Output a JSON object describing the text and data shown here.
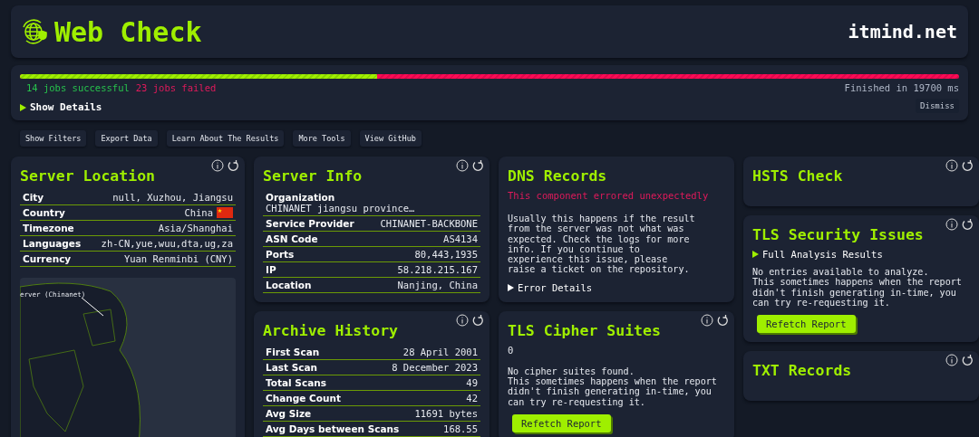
{
  "header": {
    "title": "Web Check",
    "domain": "itmind.net"
  },
  "progress": {
    "level": 0.38,
    "successful": "14 jobs successful",
    "failed": "23 jobs failed",
    "finished": "Finished in 19700 ms",
    "details": {
      "label": "Show Details",
      "expanded": false
    },
    "dismiss": "Dismiss"
  },
  "actions": [
    "Show Filters",
    "Export Data",
    "Learn About The Results",
    "More Tools",
    "View GitHub"
  ],
  "columns": [
    [
      {
        "kind": "table",
        "title": "Server Location",
        "tools": true,
        "rows": [
          {
            "label": "City",
            "value": "null, Xuzhou, Jiangsu"
          },
          {
            "label": "Country",
            "value": "China",
            "flag": true
          },
          {
            "label": "Timezone",
            "value": "Asia/Shanghai"
          },
          {
            "label": "Languages",
            "value": "zh-CN,yue,wuu,dta,ug,za"
          },
          {
            "label": "Currency",
            "value": "Yuan Renminbi (CNY)"
          }
        ],
        "map": {
          "label": "erver (Chinanet)"
        }
      }
    ],
    [
      {
        "kind": "table",
        "title": "Server Info",
        "tools": true,
        "rows": [
          {
            "label": "Organization",
            "value": "CHINANET jiangsu province…",
            "stacked": true
          },
          {
            "label": "Service Provider",
            "value": "CHINANET-BACKBONE"
          },
          {
            "label": "ASN Code",
            "value": "AS4134"
          },
          {
            "label": "Ports",
            "value": "80,443,1935"
          },
          {
            "label": "IP",
            "value": "58.218.215.167"
          },
          {
            "label": "Location",
            "value": "Nanjing, China"
          }
        ]
      },
      {
        "kind": "table",
        "title": "Archive History",
        "tools": true,
        "rows": [
          {
            "label": "First Scan",
            "value": "28 April 2001"
          },
          {
            "label": "Last Scan",
            "value": "8 December 2023"
          },
          {
            "label": "Total Scans",
            "value": "49"
          },
          {
            "label": "Change Count",
            "value": "42"
          },
          {
            "label": "Avg Size",
            "value": "11691 bytes"
          },
          {
            "label": "Avg Days between Scans",
            "value": "168.55"
          }
        ]
      }
    ],
    [
      {
        "kind": "error",
        "title": "DNS Records",
        "tools": false,
        "error": "This component errored unexpectedly",
        "text": "Usually this happens if the result from the server was not what was expected. Check the logs for more info. If you continue to experience this issue, please raise a ticket on the repository.",
        "details": {
          "label": "Error Details",
          "expanded": false
        }
      },
      {
        "kind": "empty",
        "title": "TLS Cipher Suites",
        "tools": true,
        "count": "0",
        "text": [
          "No cipher suites found.",
          "This sometimes happens when the report didn't finish generating in-time, you can try re-requesting it."
        ],
        "button": "Refetch Report"
      }
    ],
    [
      {
        "kind": "plain",
        "title": "HSTS Check",
        "tools": true
      },
      {
        "kind": "empty",
        "title": "TLS Security Issues",
        "tools": true,
        "details": {
          "label": "Full Analysis Results",
          "expanded": false
        },
        "text": [
          "No entries available to analyze.",
          "This sometimes happens when the report didn't finish generating in-time, you can try re-requesting it."
        ],
        "button": "Refetch Report"
      },
      {
        "kind": "plain",
        "title": "TXT Records",
        "tools": true
      }
    ]
  ]
}
